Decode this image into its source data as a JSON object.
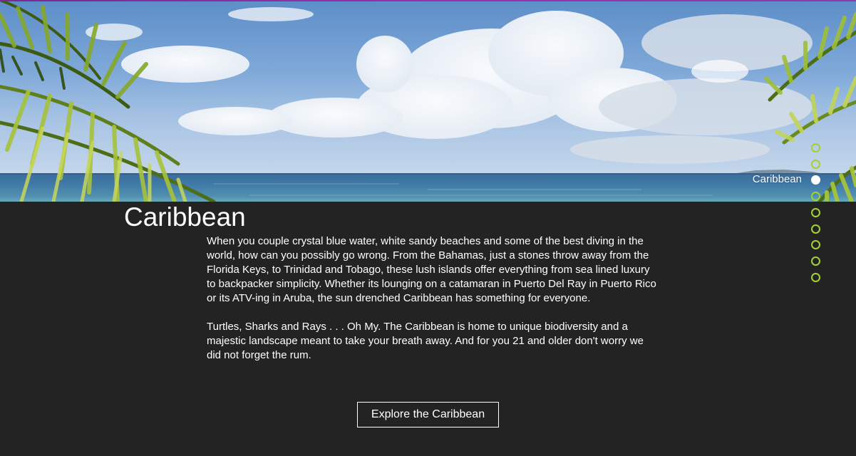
{
  "section": {
    "title": "Caribbean",
    "paragraphs": [
      "When you couple crystal blue water, white sandy beaches and some of the best diving in the world, how can you possibly go wrong. From the Bahamas, just a stones throw away from the Florida Keys, to Trinidad and Tobago, these lush islands offer everything from sea lined luxury to backpacker simplicity. Whether its lounging on a catamaran in Puerto Del Ray in Puerto Rico or its ATV-ing in Aruba, the sun drenched Caribbean has something for everyone.",
      "Turtles, Sharks and Rays  . . . Oh My. The Caribbean is home to unique biodiversity and a majestic landscape meant to take your breath away. And for you 21 and older don't worry we did not forget the rum."
    ],
    "button_label": "Explore the Caribbean"
  },
  "nav": {
    "active_label": "Caribbean",
    "dot_count": 9,
    "active_index": 2
  },
  "colors": {
    "accent_green": "#a3d133",
    "panel_background": "#232323",
    "top_accent": "#9a2fb1",
    "text": "#ffffff"
  }
}
